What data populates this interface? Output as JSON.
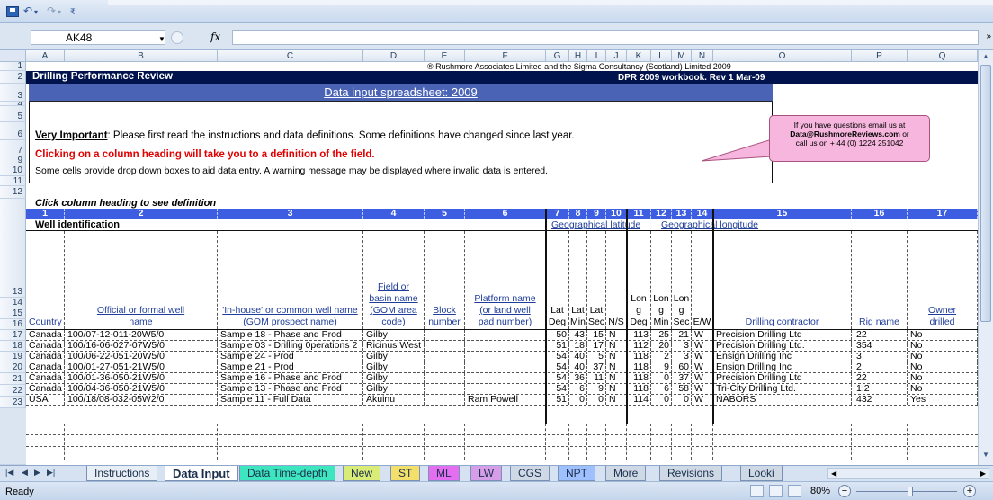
{
  "formula_bar": {
    "cell_ref": "AK48",
    "fx": "fx"
  },
  "columns": [
    "A",
    "B",
    "C",
    "D",
    "E",
    "F",
    "G",
    "H",
    "I",
    "J",
    "K",
    "L",
    "M",
    "N",
    "O",
    "P",
    "Q"
  ],
  "rows": [
    "1",
    "2",
    "3",
    "4",
    "5",
    "6",
    "7",
    "9",
    "10",
    "11",
    "12",
    "13",
    "14",
    "15",
    "16",
    "17",
    "18",
    "19",
    "20",
    "21",
    "22",
    "23"
  ],
  "sheet": {
    "copyright": "® Rushmore Associates Limited and the Sigma Consultancy (Scotland) Limited 2009",
    "banner_title": "Drilling Performance Review",
    "banner_right": "DPR 2009 workbook. Rev 1 Mar-09",
    "subtitle": "Data input spreadsheet: 2009",
    "important_label": "Very Important",
    "important_text": ": Please first read the instructions and data definitions. Some definitions have changed since last year.",
    "red_line": "Clicking on a column heading will take you to a definition of the field.",
    "note_line": "Some cells provide drop down boxes to aid data entry. A warning message may be displayed where invalid data is entered.",
    "click_heading": "Click column heading to see definition",
    "col_numbers": [
      "1",
      "2",
      "3",
      "4",
      "5",
      "6",
      "7",
      "8",
      "9",
      "10",
      "11",
      "12",
      "13",
      "14",
      "15",
      "16",
      "17"
    ],
    "well_identification": "Well identification",
    "geo_latitude": "Geographical latitude",
    "geo_longitude": "Geographical longitude",
    "headers": {
      "country": "Country",
      "official_1": "Official or formal well",
      "official_2": "name",
      "inhouse_1": "'In-house' or common well name",
      "inhouse_2": "(GOM prospect name)",
      "field_1": "Field  or",
      "field_2": "basin name",
      "field_3": "(GOM area",
      "field_4": "code)",
      "block_1": "Block",
      "block_2": "number",
      "platform_1": "Platform name",
      "platform_2": "(or land well",
      "platform_3": "pad number)",
      "lat_deg_1": "Lat",
      "lat_deg_2": "Deg",
      "lat_min_1": "Lat",
      "lat_min_2": "Min",
      "lat_sec_1": "Lat",
      "lat_sec_2": "Sec",
      "ns": "N/S",
      "lon_deg_1": "Lon",
      "lon_deg_2": "g",
      "lon_deg_3": "Deg",
      "lon_min_1": "Lon",
      "lon_min_2": "g",
      "lon_min_3": "Min",
      "lon_sec_1": "Lon",
      "lon_sec_2": "g",
      "lon_sec_3": "Sec",
      "ew": "E/W",
      "contractor": "Drilling contractor",
      "rig": "Rig name",
      "owner_1": "Owner",
      "owner_2": "drilled"
    },
    "data_rows": [
      {
        "country": "Canada",
        "official": "100/07-12-011-20W5/0",
        "inhouse": "Sample 18 - Phase and Prod",
        "field": "Gilby",
        "block": "",
        "platform": "",
        "lat_deg": "50",
        "lat_min": "43",
        "lat_sec": "15",
        "ns": "N",
        "lon_deg": "113",
        "lon_min": "25",
        "lon_sec": "21",
        "ew": "W",
        "contractor": "Precision Drilling Ltd",
        "rig": "22",
        "owner": "No"
      },
      {
        "country": "Canada",
        "official": "100/16-06-027-07W5/0",
        "inhouse": "Sample 03 - Drilling 0perations 2",
        "field": "Ricinus West",
        "block": "",
        "platform": "",
        "lat_deg": "51",
        "lat_min": "18",
        "lat_sec": "17",
        "ns": "N",
        "lon_deg": "112",
        "lon_min": "20",
        "lon_sec": "3",
        "ew": "W",
        "contractor": "Precision Drilling Ltd.",
        "rig": "354",
        "owner": "No"
      },
      {
        "country": "Canada",
        "official": "100/06-22-051-20W5/0",
        "inhouse": "Sample 24 - Prod",
        "field": "Gilby",
        "block": "",
        "platform": "",
        "lat_deg": "54",
        "lat_min": "40",
        "lat_sec": "5",
        "ns": "N",
        "lon_deg": "118",
        "lon_min": "2",
        "lon_sec": "3",
        "ew": "W",
        "contractor": "Ensign Drilling Inc",
        "rig": "3",
        "owner": "No"
      },
      {
        "country": "Canada",
        "official": "100/01-27-051-21W5/0",
        "inhouse": "Sample 21 - Prod",
        "field": "Gilby",
        "block": "",
        "platform": "",
        "lat_deg": "54",
        "lat_min": "40",
        "lat_sec": "37",
        "ns": "N",
        "lon_deg": "118",
        "lon_min": "9",
        "lon_sec": "60",
        "ew": "W",
        "contractor": "Ensign Drilling Inc",
        "rig": "2",
        "owner": "No"
      },
      {
        "country": "Canada",
        "official": "100/01-36-050-21W5/0",
        "inhouse": "Sample 16 - Phase and Prod",
        "field": "Gilby",
        "block": "",
        "platform": "",
        "lat_deg": "54",
        "lat_min": "36",
        "lat_sec": "11",
        "ns": "N",
        "lon_deg": "118",
        "lon_min": "0",
        "lon_sec": "37",
        "ew": "W",
        "contractor": "Precision Drilling Ltd",
        "rig": "22",
        "owner": "No"
      },
      {
        "country": "Canada",
        "official": "100/04-36-050-21W5/0",
        "inhouse": "Sample 13 - Phase and Prod",
        "field": "Gilby",
        "block": "",
        "platform": "",
        "lat_deg": "54",
        "lat_min": "6",
        "lat_sec": "9",
        "ns": "N",
        "lon_deg": "118",
        "lon_min": "6",
        "lon_sec": "58",
        "ew": "W",
        "contractor": "Tri-City Drilling Ltd.",
        "rig": "1;2",
        "owner": "No"
      },
      {
        "country": "USA",
        "official": "100/18/08-032-05W2/0",
        "inhouse": "Sample 11 - Full Data",
        "field": "Akuinu",
        "block": "",
        "platform": "Ram Powell",
        "lat_deg": "51",
        "lat_min": "0",
        "lat_sec": "0",
        "ns": "N",
        "lon_deg": "114",
        "lon_min": "0",
        "lon_sec": "0",
        "ew": "W",
        "contractor": "NABORS",
        "rig": "432",
        "owner": "Yes"
      }
    ]
  },
  "callout": {
    "line1": "If you  have questions email us at",
    "email": "Data@RushmoreReviews.com",
    "or": "or",
    "line3": "call us on + 44 (0) 1224 251042"
  },
  "tabs": [
    "Instructions",
    "Data Input",
    "Data Time-depth",
    "New",
    "ST",
    "ML",
    "LW",
    "CGS",
    "NPT",
    "More",
    "Revisions",
    "Looki"
  ],
  "status": {
    "ready": "Ready",
    "zoom": "80%"
  }
}
